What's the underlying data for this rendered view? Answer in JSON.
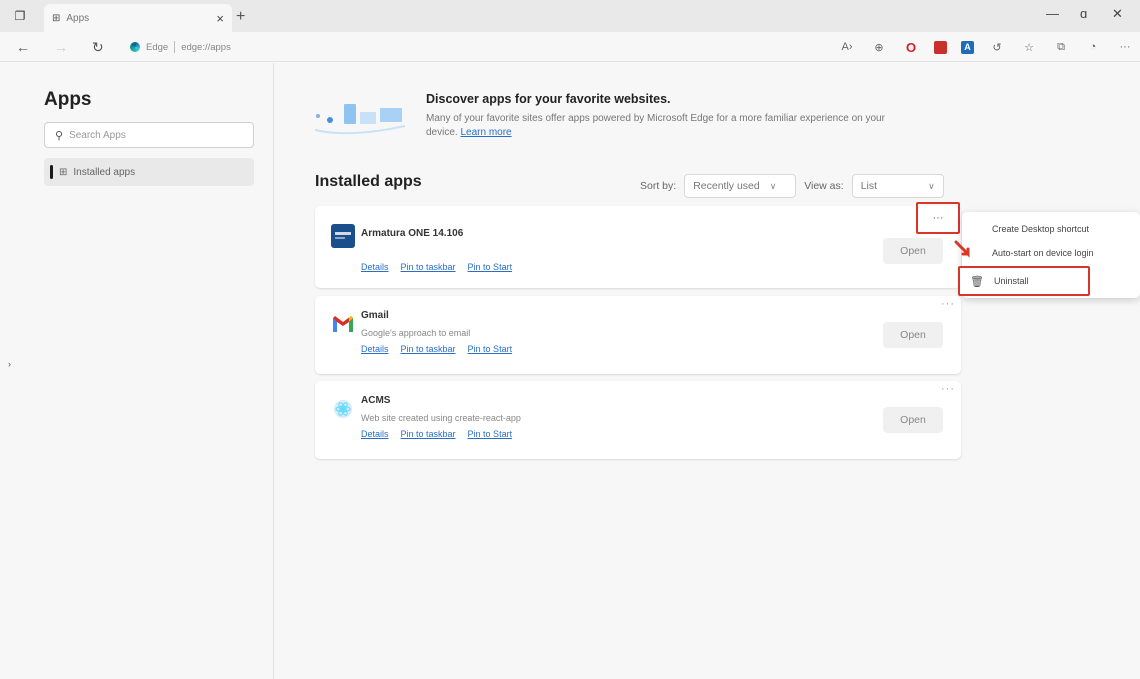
{
  "browser": {
    "tab_title": "Apps",
    "url_site": "Edge",
    "url_path": "edge://apps"
  },
  "sidebar": {
    "title": "Apps",
    "search_placeholder": "Search Apps",
    "items": [
      {
        "label": "Installed apps"
      }
    ]
  },
  "banner": {
    "title": "Discover apps for your favorite websites.",
    "description": "Many of your favorite sites offer apps powered by Microsoft Edge for a more familiar experience on your device.",
    "learn_more": "Learn more"
  },
  "installed": {
    "title": "Installed apps",
    "sort_label": "Sort by:",
    "sort_value": "Recently used",
    "view_label": "View as:",
    "view_value": "List"
  },
  "apps": [
    {
      "name": "Armatura ONE 14.106",
      "description": "",
      "links": [
        "Details",
        "Pin to taskbar",
        "Pin to Start"
      ],
      "open_label": "Open"
    },
    {
      "name": "Gmail",
      "description": "Google's approach to email",
      "links": [
        "Details",
        "Pin to taskbar",
        "Pin to Start"
      ],
      "open_label": "Open"
    },
    {
      "name": "ACMS",
      "description": "Web site created using create-react-app",
      "links": [
        "Details",
        "Pin to taskbar",
        "Pin to Start"
      ],
      "open_label": "Open"
    }
  ],
  "context_menu": {
    "items": [
      "Create Desktop shortcut",
      "Auto-start on device login"
    ],
    "uninstall": "Uninstall"
  },
  "colors": {
    "accent": "#2a6fc7",
    "highlight": "#d9362b"
  }
}
